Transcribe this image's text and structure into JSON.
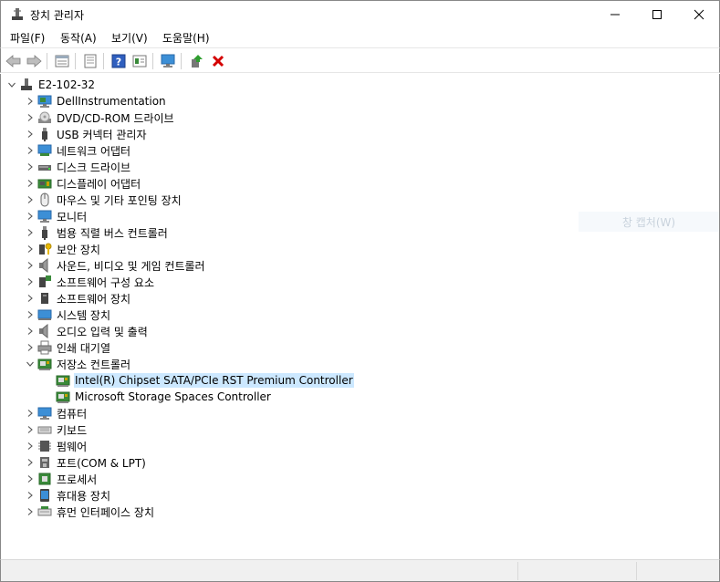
{
  "window": {
    "title": "장치 관리자",
    "minimize_icon": "minimize-icon",
    "maximize_icon": "maximize-icon",
    "close_icon": "close-icon"
  },
  "menu": [
    "파일(F)",
    "동작(A)",
    "보기(V)",
    "도움말(H)"
  ],
  "toolbar": {
    "buttons": [
      "back-arrow-icon",
      "forward-arrow-icon",
      "properties-icon",
      "list-icon",
      "help-icon",
      "details-icon",
      "monitor-icon",
      "update-driver-icon",
      "remove-icon"
    ],
    "accent_remove": "#d40000",
    "accent_update": "#2e9e2e"
  },
  "tree": {
    "root": "E2-102-32",
    "categories": [
      {
        "label": "DellInstrumentation",
        "icon": "monitor-green-icon"
      },
      {
        "label": "DVD/CD-ROM 드라이브",
        "icon": "disc-drive-icon"
      },
      {
        "label": "USB 커넥터 관리자",
        "icon": "usb-icon"
      },
      {
        "label": "네트워크 어댑터",
        "icon": "network-adapter-icon"
      },
      {
        "label": "디스크 드라이브",
        "icon": "disk-drive-icon"
      },
      {
        "label": "디스플레이 어댑터",
        "icon": "display-adapter-icon"
      },
      {
        "label": "마우스 및 기타 포인팅 장치",
        "icon": "mouse-icon"
      },
      {
        "label": "모니터",
        "icon": "monitor-icon"
      },
      {
        "label": "범용 직렬 버스 컨트롤러",
        "icon": "usb-icon"
      },
      {
        "label": "보안 장치",
        "icon": "security-key-icon"
      },
      {
        "label": "사운드, 비디오 및 게임 컨트롤러",
        "icon": "speaker-icon"
      },
      {
        "label": "소프트웨어 구성 요소",
        "icon": "software-component-icon"
      },
      {
        "label": "소프트웨어 장치",
        "icon": "software-device-icon"
      },
      {
        "label": "시스템 장치",
        "icon": "system-device-icon"
      },
      {
        "label": "오디오 입력 및 출력",
        "icon": "speaker-icon"
      },
      {
        "label": "인쇄 대기열",
        "icon": "printer-icon"
      },
      {
        "label": "저장소 컨트롤러",
        "icon": "storage-controller-icon",
        "expanded": true,
        "children": [
          {
            "label": "Intel(R) Chipset SATA/PCIe RST Premium Controller",
            "icon": "storage-controller-icon",
            "selected": true
          },
          {
            "label": "Microsoft Storage Spaces Controller",
            "icon": "storage-controller-icon"
          }
        ]
      },
      {
        "label": "컴퓨터",
        "icon": "computer-icon"
      },
      {
        "label": "키보드",
        "icon": "keyboard-icon"
      },
      {
        "label": "펌웨어",
        "icon": "firmware-icon"
      },
      {
        "label": "포트(COM & LPT)",
        "icon": "port-icon"
      },
      {
        "label": "프로세서",
        "icon": "processor-icon"
      },
      {
        "label": "휴대용 장치",
        "icon": "portable-device-icon"
      },
      {
        "label": "휴먼 인터페이스 장치",
        "icon": "hid-icon"
      }
    ]
  },
  "ghost_tooltip": "창 캡처(W)",
  "colors": {
    "selection": "#cce8ff",
    "monitor_blue": "#3c8fd6",
    "board_green": "#3a8a3a"
  }
}
